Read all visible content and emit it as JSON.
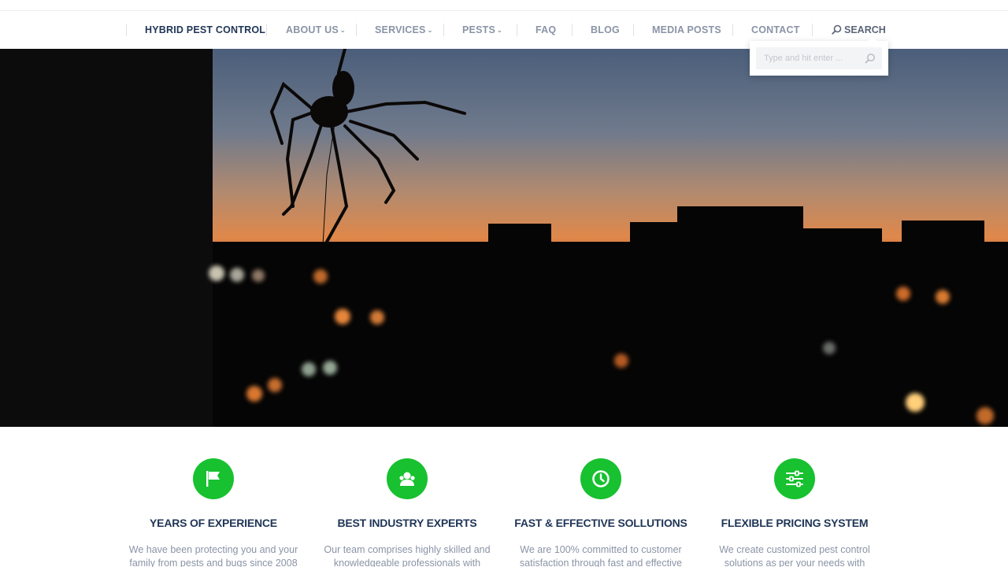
{
  "nav": {
    "items": [
      {
        "label": "HYBRID PEST CONTROL",
        "active": true,
        "has_dropdown": false
      },
      {
        "label": "ABOUT US",
        "active": false,
        "has_dropdown": true
      },
      {
        "label": "SERVICES",
        "active": false,
        "has_dropdown": true
      },
      {
        "label": "PESTS",
        "active": false,
        "has_dropdown": true
      },
      {
        "label": "FAQ",
        "active": false,
        "has_dropdown": false
      },
      {
        "label": "BLOG",
        "active": false,
        "has_dropdown": false
      },
      {
        "label": "MEDIA POSTS",
        "active": false,
        "has_dropdown": false
      },
      {
        "label": "CONTACT",
        "active": false,
        "has_dropdown": false
      }
    ],
    "search_label": "SEARCH",
    "dropdown_icon": "chevron-down-icon",
    "active_underline_color": "#2fbf3a"
  },
  "search_popup": {
    "placeholder": "Type and hit enter ...",
    "value": ""
  },
  "hero": {
    "image": "spider silhouette over city skyline at sunset"
  },
  "features": [
    {
      "icon": "flag-icon",
      "title": "YEARS OF EXPERIENCE",
      "description": "We have been protecting you and your family from pests and bugs since 2008"
    },
    {
      "icon": "user-group-icon",
      "title": "BEST INDUSTRY EXPERTS",
      "description": "Our team comprises highly skilled and knowledgeable professionals with"
    },
    {
      "icon": "clock-icon",
      "title": "FAST & EFFECTIVE SOLLUTIONS",
      "description": "We are 100% committed to customer satisfaction through fast and effective"
    },
    {
      "icon": "sliders-icon",
      "title": "FLEXIBLE PRICING SYSTEM",
      "description": "We create customized pest control solutions as per your needs with"
    }
  ],
  "colors": {
    "brand_green": "#17c12f",
    "heading_navy": "#1f3556",
    "muted_text": "#8a94a6"
  }
}
